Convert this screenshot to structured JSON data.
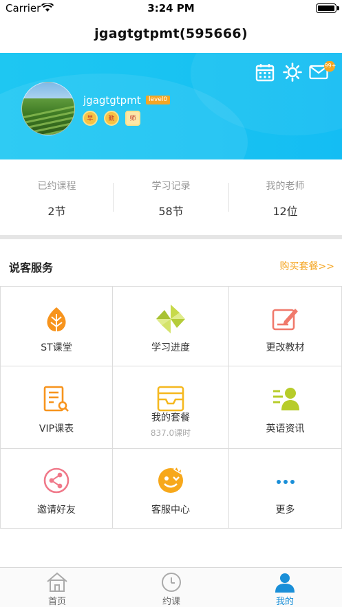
{
  "status_bar": {
    "carrier": "Carrier",
    "time": "3:24 PM"
  },
  "navbar": {
    "title": "jgagtgtpmt(595666)"
  },
  "profile": {
    "username": "jgagtgtpmt",
    "level": "level0",
    "badge_count": "99+",
    "medals": [
      "早",
      "勤",
      "师"
    ]
  },
  "stats": [
    {
      "label": "已约课程",
      "value": "2节"
    },
    {
      "label": "学习记录",
      "value": "58节"
    },
    {
      "label": "我的老师",
      "value": "12位"
    }
  ],
  "service": {
    "title": "说客服务",
    "buy_link": "购买套餐>>",
    "items": [
      {
        "label": "ST课堂",
        "icon": "leaf-icon"
      },
      {
        "label": "学习进度",
        "icon": "pinwheel-icon"
      },
      {
        "label": "更改教材",
        "icon": "edit-book-icon"
      },
      {
        "label": "VIP课表",
        "icon": "schedule-search-icon"
      },
      {
        "label": "我的套餐",
        "sub": "837.0课时",
        "icon": "inbox-icon"
      },
      {
        "label": "英语资讯",
        "icon": "news-person-icon"
      },
      {
        "label": "邀请好友",
        "icon": "share-icon"
      },
      {
        "label": "客服中心",
        "icon": "service-face-icon"
      },
      {
        "label": "更多",
        "icon": "more-icon"
      }
    ]
  },
  "tabbar": {
    "tabs": [
      {
        "label": "首页",
        "icon": "home-icon"
      },
      {
        "label": "约课",
        "icon": "clock-icon"
      },
      {
        "label": "我的",
        "icon": "person-icon"
      }
    ],
    "active": "我的"
  },
  "colors": {
    "accent": "#1ec7f2",
    "orange": "#f5a623",
    "active_tab": "#1a8fd8"
  }
}
